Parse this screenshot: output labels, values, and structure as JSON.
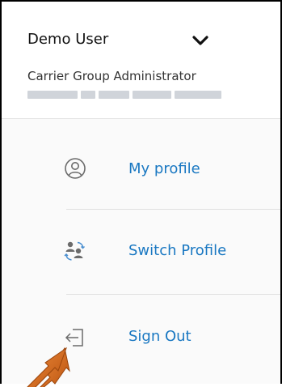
{
  "header": {
    "user_name": "Demo User",
    "user_role": "Carrier Group Administrator"
  },
  "menu": {
    "items": [
      {
        "label": "My profile",
        "icon": "user-circle-icon"
      },
      {
        "label": "Switch Profile",
        "icon": "switch-users-icon"
      },
      {
        "label": "Sign Out",
        "icon": "sign-out-icon"
      }
    ]
  },
  "colors": {
    "link": "#1a78c2",
    "icon_gray": "#6b6b6b",
    "menu_bg": "#fafafa",
    "arrow": "#d96a1c",
    "border": "#000000"
  }
}
